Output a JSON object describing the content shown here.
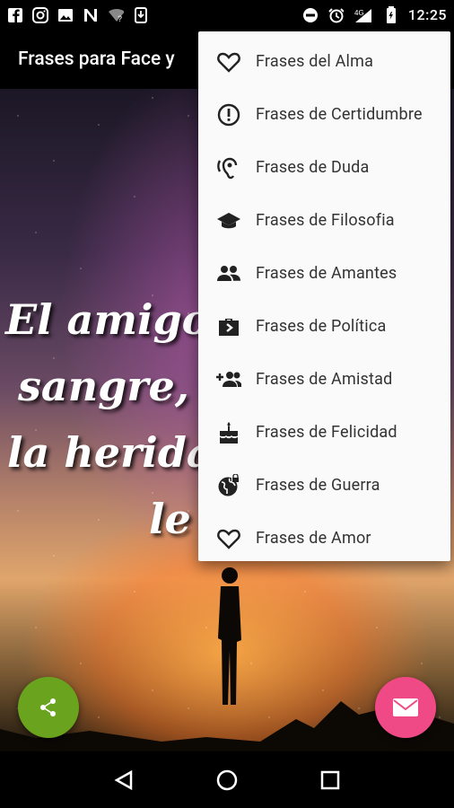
{
  "status_bar": {
    "time": "12:25",
    "network": "4G",
    "left_icons": [
      "facebook-icon",
      "instagram-icon",
      "image-icon",
      "n-icon",
      "wifi-question-icon",
      "download-icon"
    ],
    "right_icons": [
      "dnd-icon",
      "alarm-icon",
      "signal-icon",
      "battery-icon"
    ]
  },
  "app_bar": {
    "title": "Frases para Face y"
  },
  "hero": {
    "quote_lines": [
      "El amigo ha",
      "sangre, que",
      "la herida si",
      "le l"
    ]
  },
  "menu": {
    "items": [
      {
        "label": "Frases del Alma",
        "icon": "heart-outline-icon"
      },
      {
        "label": "Frases de Certidumbre",
        "icon": "alert-circle-icon"
      },
      {
        "label": "Frases de Duda",
        "icon": "hearing-icon"
      },
      {
        "label": "Frases de Filosofia",
        "icon": "graduation-cap-icon"
      },
      {
        "label": "Frases de Amantes",
        "icon": "group-icon"
      },
      {
        "label": "Frases de Política",
        "icon": "briefcase-arrow-icon"
      },
      {
        "label": "Frases de Amistad",
        "icon": "group-add-icon"
      },
      {
        "label": "Frases de Felicidad",
        "icon": "cake-icon"
      },
      {
        "label": "Frases de Guerra",
        "icon": "globe-lock-icon"
      },
      {
        "label": "Frases de Amor",
        "icon": "heart-outline-icon"
      }
    ]
  },
  "fabs": {
    "share": {
      "icon": "share-icon",
      "color": "#6aa41f"
    },
    "mail": {
      "icon": "mail-icon",
      "color": "#ef4a85"
    }
  },
  "nav_bar": {
    "buttons": [
      "back-triangle-icon",
      "home-circle-icon",
      "recents-square-icon"
    ]
  }
}
